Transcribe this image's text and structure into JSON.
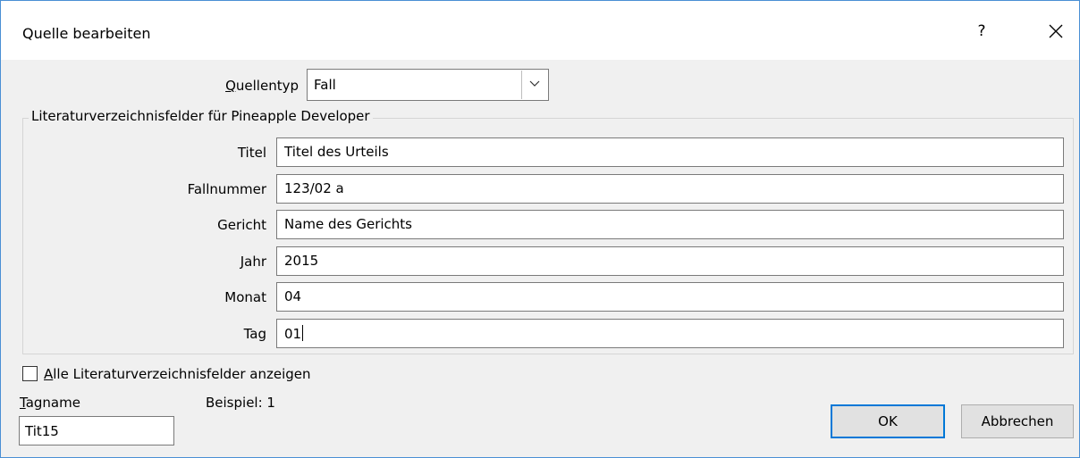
{
  "window": {
    "title": "Quelle bearbeiten",
    "help_label": "?",
    "close_label": "✕"
  },
  "source_type": {
    "label": "Quellentyp",
    "value": "Fall"
  },
  "bibliography_group": {
    "label": "Literaturverzeichnisfelder für Pineapple Developer",
    "fields": [
      {
        "label": "Titel",
        "value": "Titel des Urteils"
      },
      {
        "label": "Fallnummer",
        "value": "123/02 a"
      },
      {
        "label": "Gericht",
        "value": "Name des Gerichts"
      },
      {
        "label": "Jahr",
        "value": "2015"
      },
      {
        "label": "Monat",
        "value": "04"
      },
      {
        "label": "Tag",
        "value": "01"
      }
    ]
  },
  "show_all": {
    "label": "Alle Literaturverzeichnisfelder anzeigen",
    "checked": false
  },
  "tag": {
    "label": "Tagname",
    "value": "Tit15",
    "example": "Beispiel: 1"
  },
  "buttons": {
    "ok": "OK",
    "cancel": "Abbrechen"
  }
}
